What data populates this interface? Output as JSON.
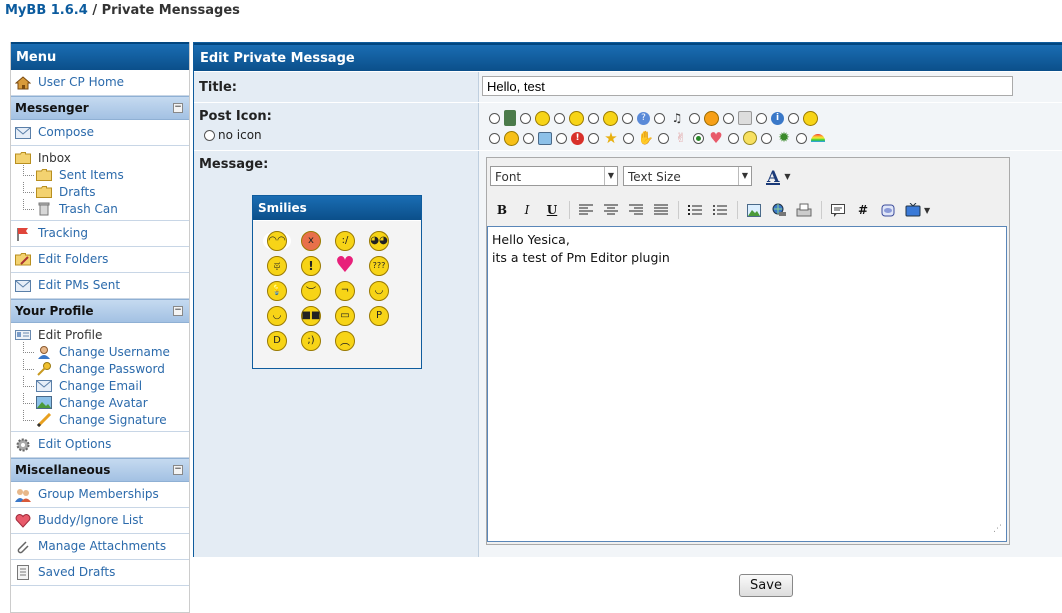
{
  "breadcrumb": {
    "home": "MyBB 1.6.4",
    "separator": "/",
    "current": "Private Menssages"
  },
  "sidebar": {
    "menu_title": "Menu",
    "usercp_home": "User CP Home",
    "messenger": {
      "title": "Messenger",
      "toggle": "−",
      "compose": "Compose",
      "inbox": "Inbox",
      "sent_items": "Sent Items",
      "drafts": "Drafts",
      "trash_can": "Trash Can",
      "tracking": "Tracking",
      "edit_folders": "Edit Folders",
      "edit_pms_sent": "Edit PMs Sent"
    },
    "profile": {
      "title": "Your Profile",
      "toggle": "−",
      "edit_profile": "Edit Profile",
      "change_username": "Change Username",
      "change_password": "Change Password",
      "change_email": "Change Email",
      "change_avatar": "Change Avatar",
      "change_signature": "Change Signature",
      "edit_options": "Edit Options"
    },
    "misc": {
      "title": "Miscellaneous",
      "toggle": "−",
      "group_memberships": "Group Memberships",
      "buddy_ignore": "Buddy/Ignore List",
      "manage_attachments": "Manage Attachments",
      "saved_drafts": "Saved Drafts"
    }
  },
  "main": {
    "header": "Edit Private Message",
    "title_label": "Title:",
    "title_value": "Hello, test",
    "post_icon_label": "Post Icon:",
    "no_icon_label": "no icon",
    "message_label": "Message:",
    "smilies_title": "Smilies",
    "editor": {
      "font_select": "Font",
      "size_select": "Text Size",
      "bold": "B",
      "italic": "I",
      "underline": "U",
      "hash": "#",
      "message_line1": "Hello Yesica,",
      "message_line2": "its a test of Pm Editor plugin"
    },
    "save_label": "Save"
  },
  "colors": {
    "header_blue": "#0f5c9d",
    "category_blue": "#a9c6e6",
    "link": "#2b6aab"
  }
}
